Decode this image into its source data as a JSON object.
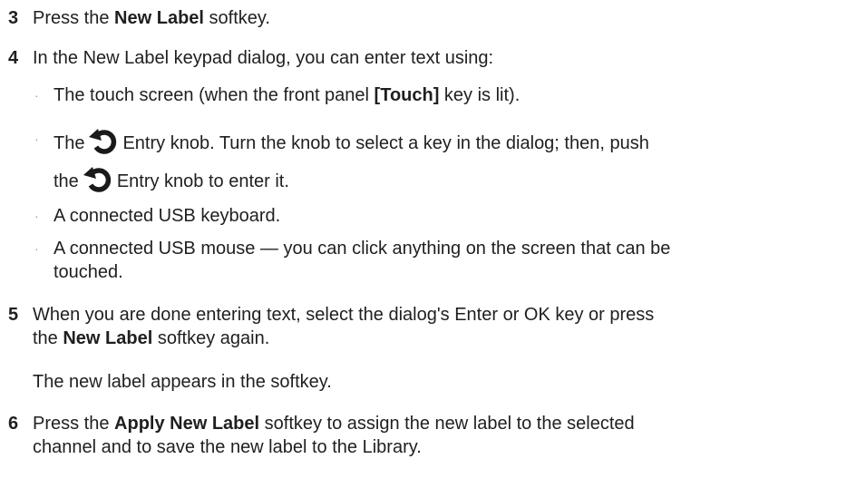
{
  "steps": {
    "s3": {
      "num": "3",
      "pre": "Press the ",
      "bold": "New Label",
      "post": " softkey."
    },
    "s4": {
      "num": "4",
      "text": "In the New Label keypad dialog, you can enter text using:"
    },
    "b1": {
      "pre": "The touch screen (when the front panel ",
      "bold": "[Touch]",
      "post": " key is lit)."
    },
    "b2": {
      "pre": "The",
      "post": "Entry knob. Turn the knob to select a key in the dialog; then, push"
    },
    "b2b": {
      "pre": "the",
      "post": "Entry knob to enter it."
    },
    "b3": {
      "text": "A connected USB keyboard."
    },
    "b4": {
      "line1": "A connected USB mouse — you can click anything on the screen that can be",
      "line2": "touched."
    },
    "s5": {
      "num": "5",
      "line1": "When you are done entering text, select the dialog's Enter or OK key or press",
      "pre2": "the ",
      "bold2": "New Label",
      "post2": " softkey again."
    },
    "s5note": {
      "text": "The new label appears in the softkey."
    },
    "s6": {
      "num": "6",
      "pre": "Press the ",
      "bold": "Apply New Label",
      "post": " softkey to assign the new label to the selected",
      "line2": "channel and to save the new label to the Library."
    }
  },
  "bullet_char": "·",
  "icons": {
    "knob": "entry-knob-icon"
  },
  "colors": {
    "text": "#1f1f1f",
    "bullet": "#9a9a9a",
    "icon": "#1a1a1a"
  }
}
